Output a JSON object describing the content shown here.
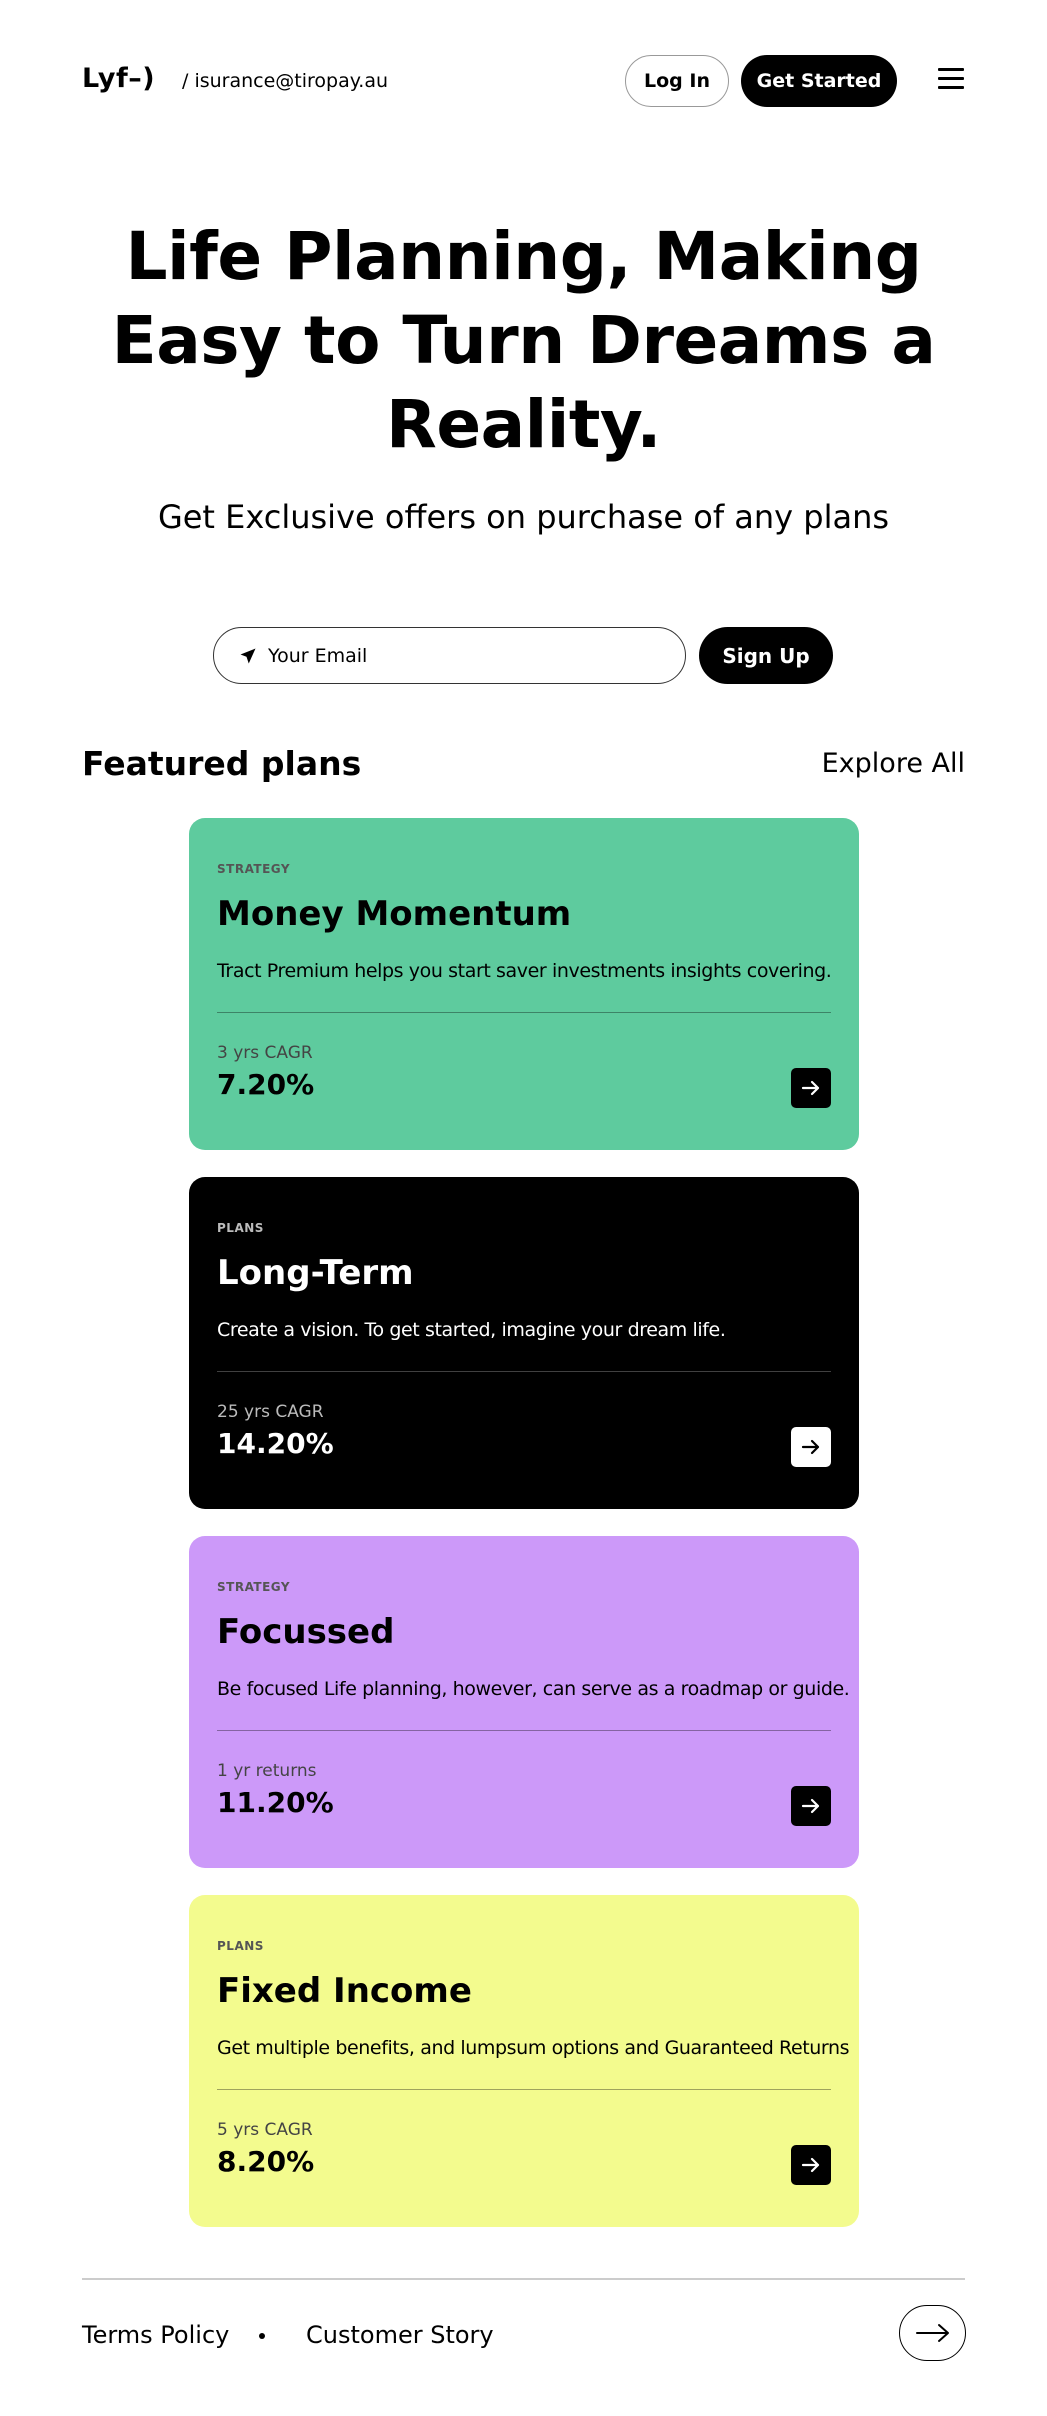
{
  "header": {
    "logo": "Lyf–)",
    "email": "/ isurance@tiropay.au",
    "login_label": "Log In",
    "get_started_label": "Get Started",
    "menu_icon": "hamburger-menu-icon"
  },
  "hero": {
    "title": "Life Planning, Making Easy to Turn Dreams a Reality.",
    "subtitle": "Get Exclusive offers on purchase of any plans"
  },
  "signup": {
    "email_placeholder": "Your Email",
    "button_label": "Sign Up",
    "icon": "paper-plane-icon"
  },
  "featured": {
    "title": "Featured plans",
    "explore_label": "Explore All",
    "cards": [
      {
        "tag": "STRATEGY",
        "title": "Money Momentum",
        "description": "Tract Premium helps you start saver investments insights covering.",
        "metric_label": "3 yrs CAGR",
        "metric_value": "7.20%",
        "color": "#5ecb9e"
      },
      {
        "tag": "PLANS",
        "title": "Long-Term",
        "description": "Create a vision. To get started, imagine your dream life.",
        "metric_label": "25 yrs CAGR",
        "metric_value": "14.20%",
        "color": "#000000"
      },
      {
        "tag": "STRATEGY",
        "title": "Focussed",
        "description": "Be focused Life planning, however, can serve as a roadmap or guide.",
        "metric_label": "1 yr returns",
        "metric_value": "11.20%",
        "color": "#cc99f9"
      },
      {
        "tag": "PLANS",
        "title": "Fixed Income",
        "description": "Get multiple benefits, and lumpsum options and Guaranteed Returns",
        "metric_label": "5 yrs CAGR",
        "metric_value": "8.20%",
        "color": "#f3fb8e"
      }
    ]
  },
  "footer": {
    "terms_label": "Terms Policy",
    "story_label": "Customer Story",
    "arrow_icon": "arrow-right-icon"
  }
}
